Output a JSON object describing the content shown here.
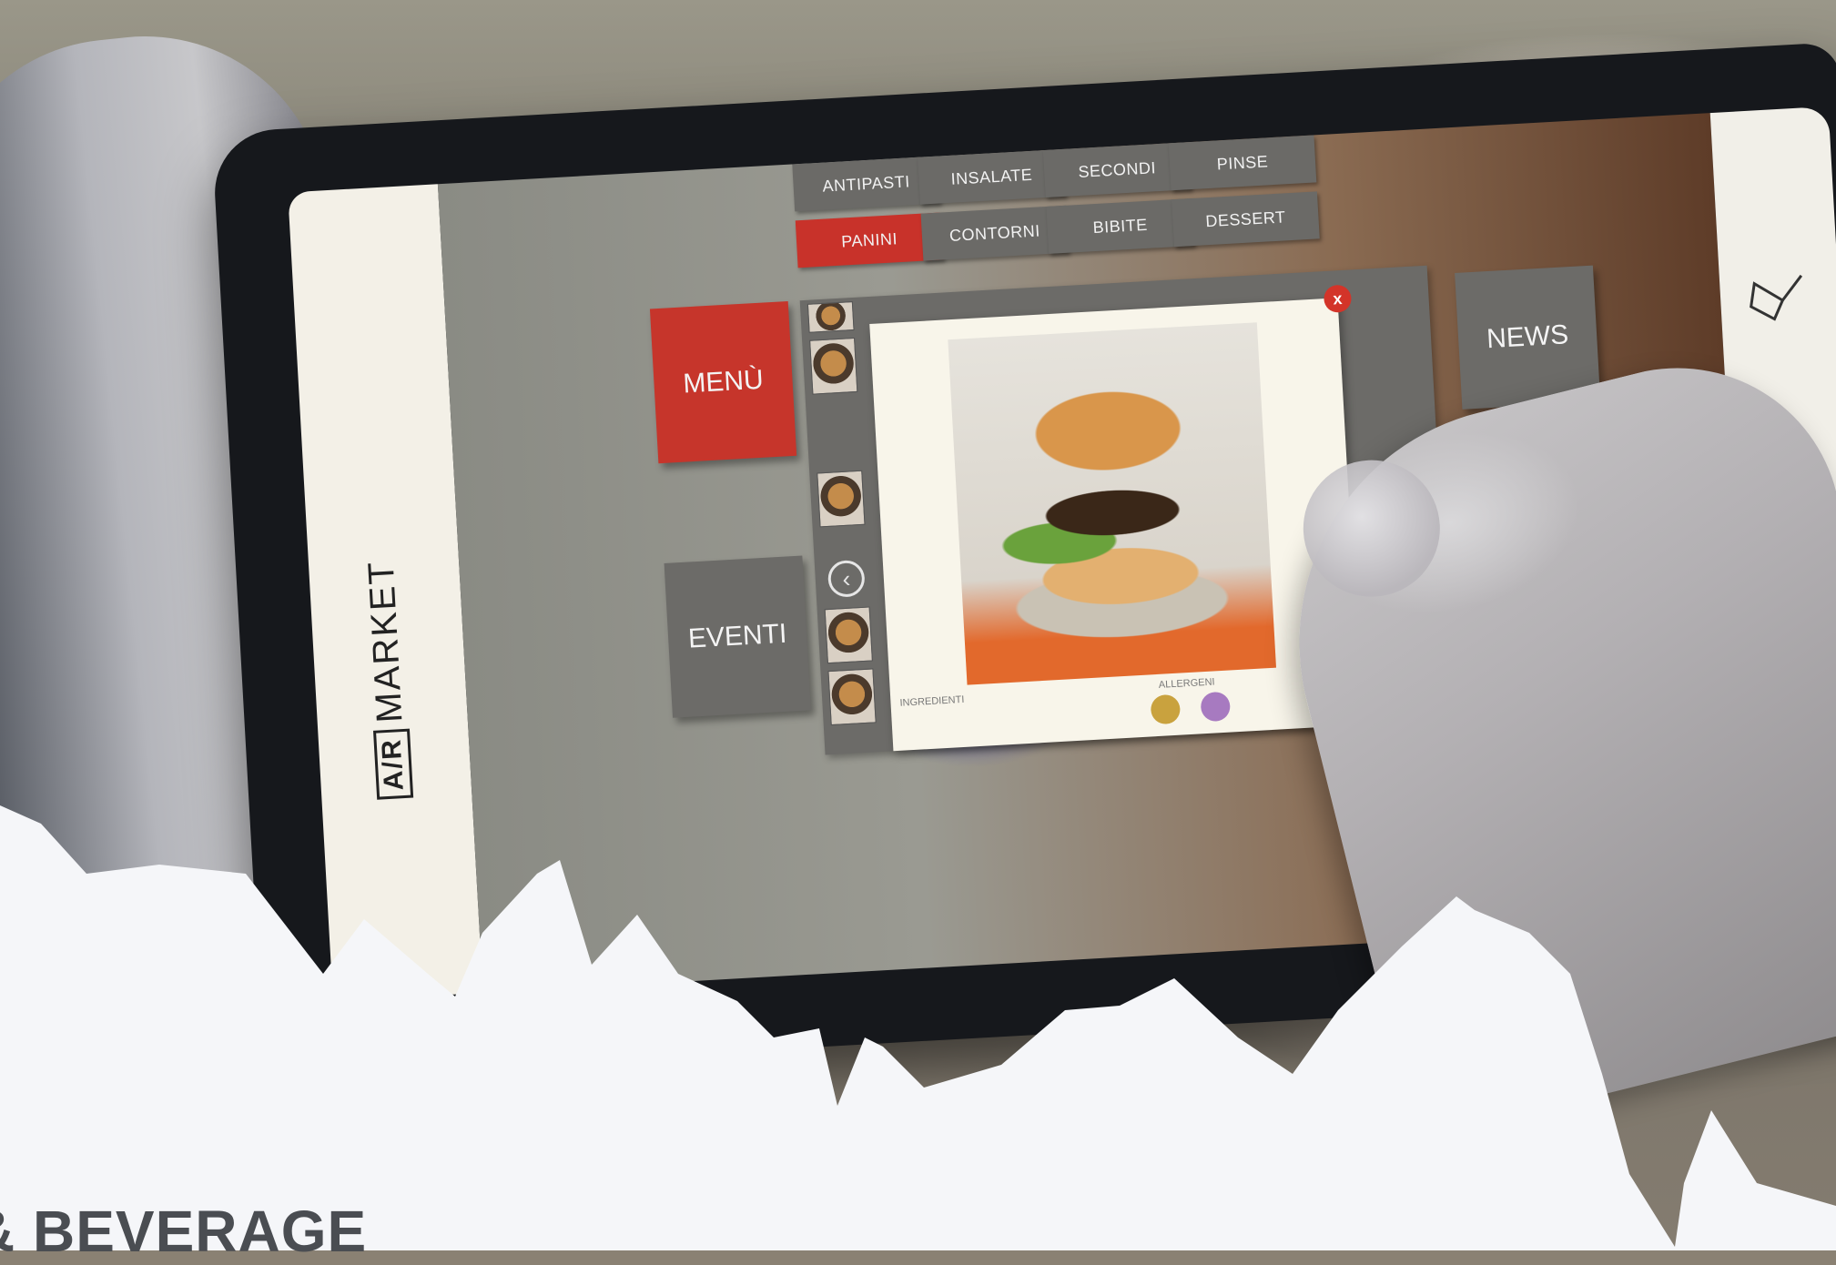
{
  "app": {
    "brand_logo": "A/R",
    "brand_name": "MARKET"
  },
  "categories": {
    "row1": [
      "ANTIPASTI",
      "INSALATE",
      "SECONDI",
      "PINSE"
    ],
    "row2": [
      "PANINI",
      "CONTORNI",
      "BIBITE",
      "DESSERT"
    ],
    "active": "PANINI"
  },
  "tiles": {
    "menu": "MENÙ",
    "eventi": "EVENTI",
    "news": "NEWS"
  },
  "detail": {
    "close_label": "x",
    "ingredients_title": "INGREDIENTI",
    "allergens_title": "ALLERGENI"
  },
  "colors": {
    "accent": "#c8322a",
    "tile": "#6c6b68",
    "overlay": "#f5f6f9"
  },
  "icons": [
    "broom-icon",
    "camera-shutter-icon",
    "chevron-left-icon",
    "close-icon"
  ],
  "footer": {
    "section_title": "& BEVERAGE"
  }
}
